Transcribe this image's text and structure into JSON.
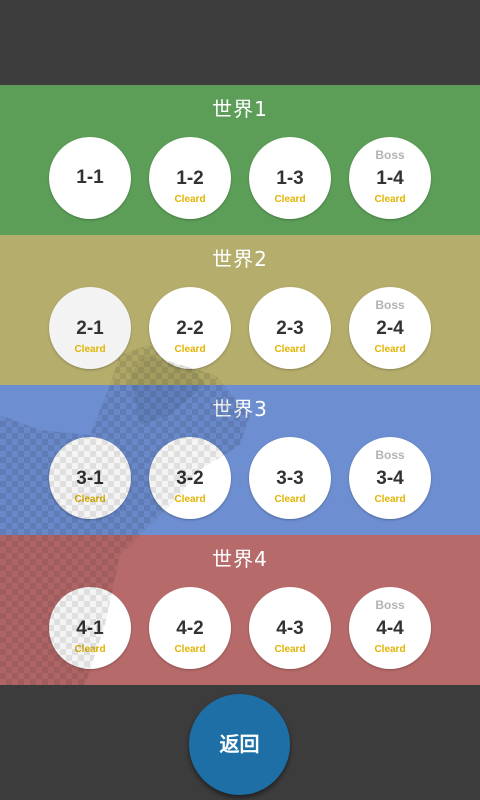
{
  "colors": {
    "background": "#3c3c3c",
    "cleared_text": "#e2b400",
    "back_button": "#1d6fa5"
  },
  "worlds": [
    {
      "title": "世界1",
      "color": "#5c9e58",
      "stages": [
        {
          "label": "1-1",
          "boss": "",
          "status": ""
        },
        {
          "label": "1-2",
          "boss": "",
          "status": "Cleard"
        },
        {
          "label": "1-3",
          "boss": "",
          "status": "Cleard"
        },
        {
          "label": "1-4",
          "boss": "Boss",
          "status": "Cleard"
        }
      ]
    },
    {
      "title": "世界2",
      "color": "#b5ad6c",
      "stages": [
        {
          "label": "2-1",
          "boss": "",
          "status": "Cleard"
        },
        {
          "label": "2-2",
          "boss": "",
          "status": "Cleard"
        },
        {
          "label": "2-3",
          "boss": "",
          "status": "Cleard"
        },
        {
          "label": "2-4",
          "boss": "Boss",
          "status": "Cleard"
        }
      ]
    },
    {
      "title": "世界3",
      "color": "#6d8ed0",
      "stages": [
        {
          "label": "3-1",
          "boss": "",
          "status": "Cleard"
        },
        {
          "label": "3-2",
          "boss": "",
          "status": "Cleard"
        },
        {
          "label": "3-3",
          "boss": "",
          "status": "Cleard"
        },
        {
          "label": "3-4",
          "boss": "Boss",
          "status": "Cleard"
        }
      ]
    },
    {
      "title": "世界4",
      "color": "#b76a6a",
      "stages": [
        {
          "label": "4-1",
          "boss": "",
          "status": "Cleard"
        },
        {
          "label": "4-2",
          "boss": "",
          "status": "Cleard"
        },
        {
          "label": "4-3",
          "boss": "",
          "status": "Cleard"
        },
        {
          "label": "4-4",
          "boss": "Boss",
          "status": "Cleard"
        }
      ]
    }
  ],
  "back_button": {
    "label": "返回"
  }
}
